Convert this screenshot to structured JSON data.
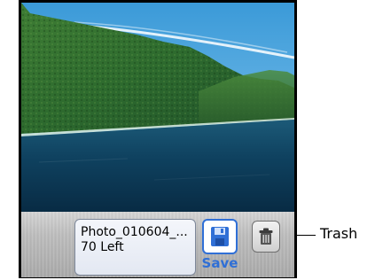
{
  "photo": {
    "subject": "mountain-lake-landscape"
  },
  "info": {
    "filename": "Photo_010604_...",
    "remaining": "70 Left"
  },
  "buttons": {
    "save_label": "Save",
    "save_icon": "floppy-disk-icon",
    "trash_icon": "trash-can-icon"
  },
  "callout": {
    "label": "Trash"
  },
  "colors": {
    "accent": "#2f6fd6",
    "sky": "#4aa3df",
    "water": "#0e3c5a",
    "forest": "#2f6b2d"
  }
}
